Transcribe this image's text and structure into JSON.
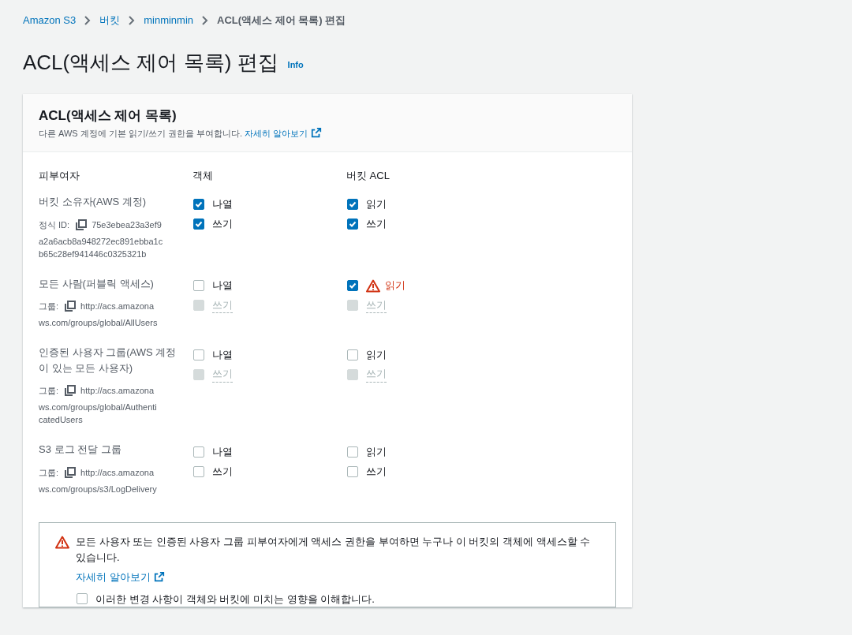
{
  "breadcrumb": [
    {
      "label": "Amazon S3",
      "current": false
    },
    {
      "label": "버킷",
      "current": false
    },
    {
      "label": "minminmin",
      "current": false
    },
    {
      "label": "ACL(액세스 제어 목록) 편집",
      "current": true
    }
  ],
  "page_title": "ACL(액세스 제어 목록) 편집",
  "info_link": "Info",
  "panel": {
    "title": "ACL(액세스 제어 목록)",
    "description": "다른 AWS 계정에 기본 읽기/쓰기 권한을 부여합니다.",
    "learn_more": "자세히 알아보기",
    "columns": [
      "피부여자",
      "객체",
      "버킷 ACL"
    ],
    "grantees": [
      {
        "name": "버킷 소유자(AWS 계정)",
        "id_label": "정식 ID:",
        "id_lines": [
          "75e3ebea23a3ef9",
          "a2a6acb8a948272ec891ebba1c",
          "b65c28ef941446c0325321b"
        ],
        "objects": [
          {
            "label": "나열",
            "checked": true,
            "disabled": false,
            "warning": false
          },
          {
            "label": "쓰기",
            "checked": true,
            "disabled": false,
            "warning": false
          }
        ],
        "bucket_acl": [
          {
            "label": "읽기",
            "checked": true,
            "disabled": false,
            "warning": false
          },
          {
            "label": "쓰기",
            "checked": true,
            "disabled": false,
            "warning": false
          }
        ]
      },
      {
        "name": "모든 사람(퍼블릭 액세스)",
        "id_label": "그룹:",
        "id_lines": [
          "http://acs.amazona",
          "ws.com/groups/global/AllUsers"
        ],
        "objects": [
          {
            "label": "나열",
            "checked": false,
            "disabled": false,
            "warning": false
          },
          {
            "label": "쓰기",
            "checked": false,
            "disabled": true,
            "warning": false
          }
        ],
        "bucket_acl": [
          {
            "label": "읽기",
            "checked": true,
            "disabled": false,
            "warning": true
          },
          {
            "label": "쓰기",
            "checked": false,
            "disabled": true,
            "warning": false
          }
        ]
      },
      {
        "name": "인증된 사용자 그룹(AWS 계정이 있는 모든 사용자)",
        "id_label": "그룹:",
        "id_lines": [
          "http://acs.amazona",
          "ws.com/groups/global/Authenti",
          "catedUsers"
        ],
        "objects": [
          {
            "label": "나열",
            "checked": false,
            "disabled": false,
            "warning": false
          },
          {
            "label": "쓰기",
            "checked": false,
            "disabled": true,
            "warning": false
          }
        ],
        "bucket_acl": [
          {
            "label": "읽기",
            "checked": false,
            "disabled": false,
            "warning": false
          },
          {
            "label": "쓰기",
            "checked": false,
            "disabled": true,
            "warning": false
          }
        ]
      },
      {
        "name": "S3 로그 전달 그룹",
        "id_label": "그룹:",
        "id_lines": [
          "http://acs.amazona",
          "ws.com/groups/s3/LogDelivery"
        ],
        "objects": [
          {
            "label": "나열",
            "checked": false,
            "disabled": false,
            "warning": false
          },
          {
            "label": "쓰기",
            "checked": false,
            "disabled": false,
            "warning": false
          }
        ],
        "bucket_acl": [
          {
            "label": "읽기",
            "checked": false,
            "disabled": false,
            "warning": false
          },
          {
            "label": "쓰기",
            "checked": false,
            "disabled": false,
            "warning": false
          }
        ]
      }
    ],
    "warning": {
      "message": "모든 사용자 또는 인증된 사용자 그룹 피부여자에게 액세스 권한을 부여하면 누구나 이 버킷의 객체에 액세스할 수 있습니다.",
      "learn_more": "자세히 알아보기",
      "acknowledge": {
        "label": "이러한 변경 사항이 객체와 버킷에 미치는 영향을 이해합니다.",
        "checked": false
      }
    }
  }
}
